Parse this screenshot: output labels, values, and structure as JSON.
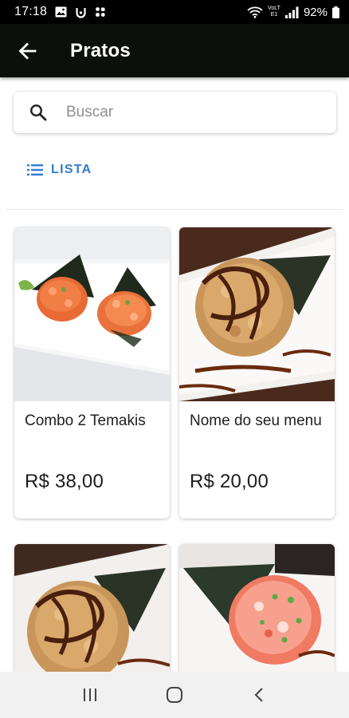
{
  "status_bar": {
    "time": "17:18",
    "battery": "92%",
    "network_label": "VoLTE1",
    "icons": [
      "image-icon",
      "alarm-icon",
      "grid-apps-icon",
      "wifi-icon",
      "signal-icon",
      "battery-icon"
    ]
  },
  "app_bar": {
    "title": "Pratos",
    "back_icon": "arrow-left-icon",
    "background": "#0d0f0c"
  },
  "search": {
    "placeholder": "Buscar",
    "value": ""
  },
  "view_toggle": {
    "label": "LISTA",
    "icon": "list-icon",
    "color": "#2f7bd0"
  },
  "products": [
    {
      "name": "Combo 2 Temakis",
      "price": "R$ 38,00"
    },
    {
      "name": "Nome do seu menu",
      "price": "R$ 20,00"
    },
    {
      "name": "",
      "price": ""
    },
    {
      "name": "",
      "price": ""
    }
  ],
  "nav_bar": {
    "icons": [
      "recent-apps-icon",
      "home-icon",
      "back-icon"
    ]
  }
}
